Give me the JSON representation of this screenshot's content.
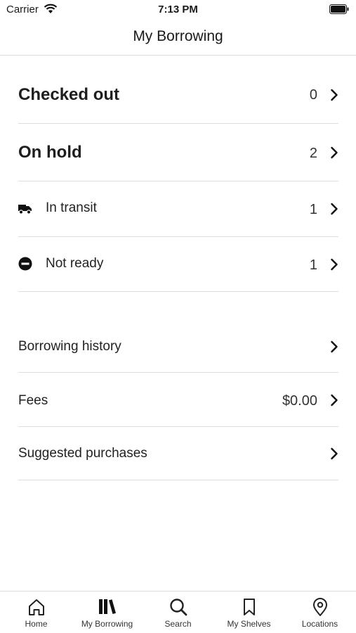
{
  "status_bar": {
    "carrier": "Carrier",
    "time": "7:13 PM"
  },
  "nav": {
    "title": "My Borrowing"
  },
  "rows": {
    "checked_out": {
      "label": "Checked out",
      "count": "0"
    },
    "on_hold": {
      "label": "On hold",
      "count": "2"
    },
    "in_transit": {
      "label": "In transit",
      "count": "1",
      "icon": "truck-icon"
    },
    "not_ready": {
      "label": "Not ready",
      "count": "1",
      "icon": "minus-circle-icon"
    },
    "borrowing_history": {
      "label": "Borrowing history"
    },
    "fees": {
      "label": "Fees",
      "value": "$0.00"
    },
    "suggested_purchases": {
      "label": "Suggested purchases"
    }
  },
  "tabs": [
    {
      "label": "Home",
      "icon": "home-icon"
    },
    {
      "label": "My Borrowing",
      "icon": "books-icon"
    },
    {
      "label": "Search",
      "icon": "search-icon"
    },
    {
      "label": "My Shelves",
      "icon": "bookmark-icon"
    },
    {
      "label": "Locations",
      "icon": "location-pin-icon"
    }
  ]
}
